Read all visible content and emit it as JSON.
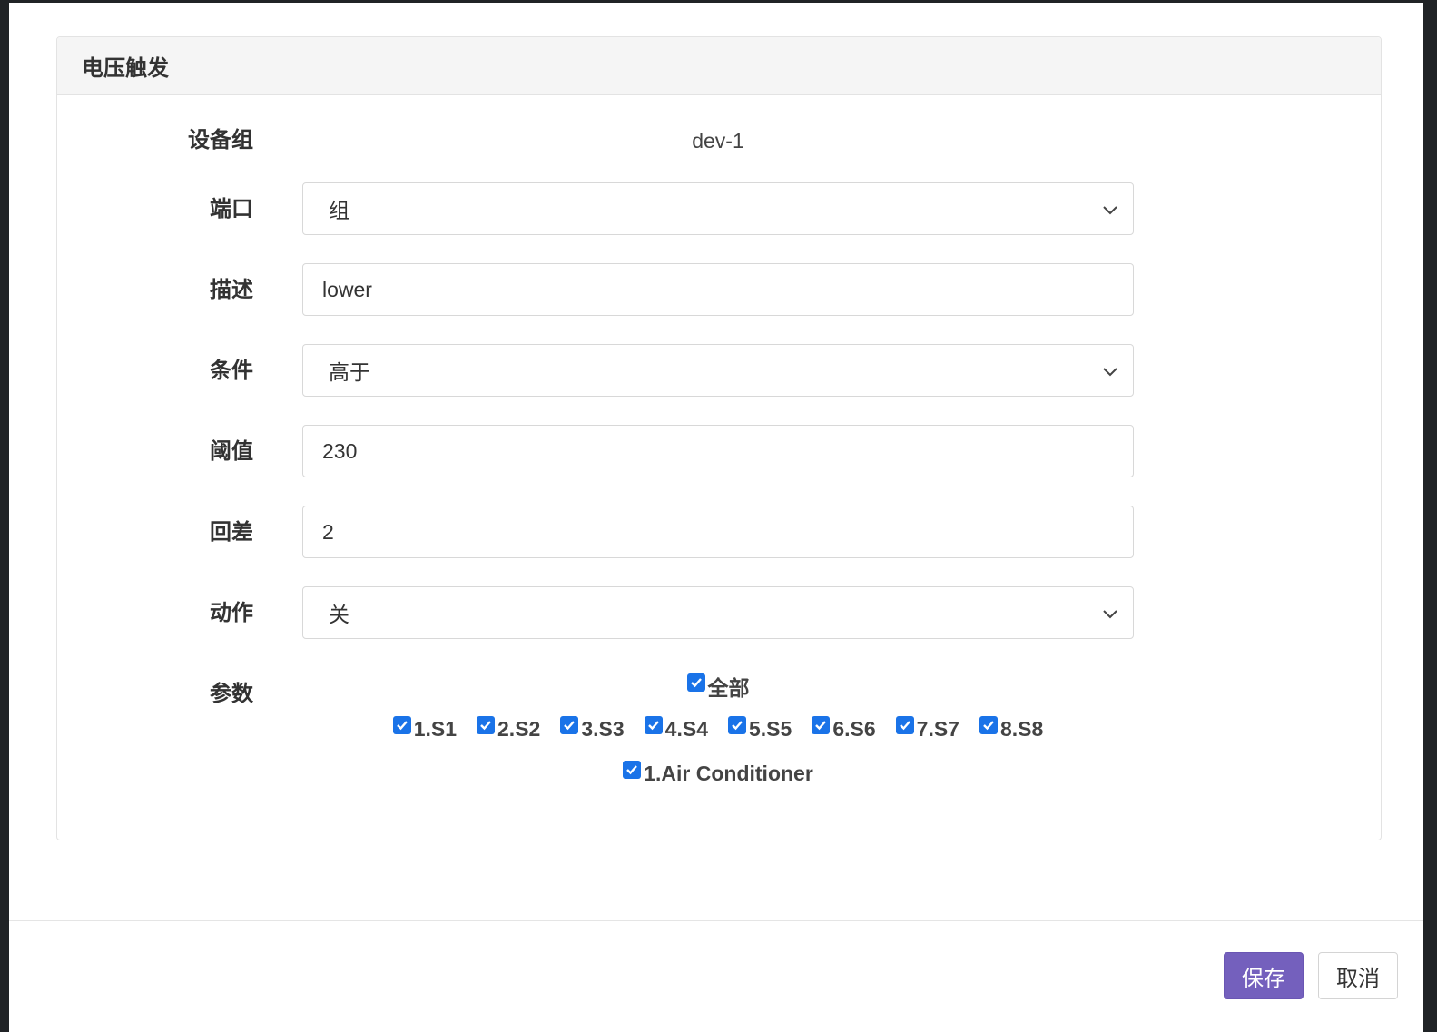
{
  "card": {
    "title": "电压触发"
  },
  "form": {
    "device_group": {
      "label": "设备组",
      "value": "dev-1"
    },
    "port": {
      "label": "端口",
      "value": "组"
    },
    "description": {
      "label": "描述",
      "value": "lower"
    },
    "condition": {
      "label": "条件",
      "value": "高于"
    },
    "threshold": {
      "label": "阈值",
      "value": "230"
    },
    "hysteresis": {
      "label": "回差",
      "value": "2"
    },
    "action": {
      "label": "动作",
      "value": "关"
    },
    "params": {
      "label": "参数",
      "all": {
        "label": "全部",
        "checked": true
      },
      "outlets": [
        {
          "label": "1.S1",
          "checked": true
        },
        {
          "label": "2.S2",
          "checked": true
        },
        {
          "label": "3.S3",
          "checked": true
        },
        {
          "label": "4.S4",
          "checked": true
        },
        {
          "label": "5.S5",
          "checked": true
        },
        {
          "label": "6.S6",
          "checked": true
        },
        {
          "label": "7.S7",
          "checked": true
        },
        {
          "label": "8.S8",
          "checked": true
        }
      ],
      "devices": [
        {
          "label": "1.Air Conditioner",
          "checked": true
        }
      ]
    }
  },
  "footer": {
    "save_label": "保存",
    "cancel_label": "取消"
  },
  "colors": {
    "primary": "#7460bd",
    "checkbox": "#1a73e8"
  }
}
